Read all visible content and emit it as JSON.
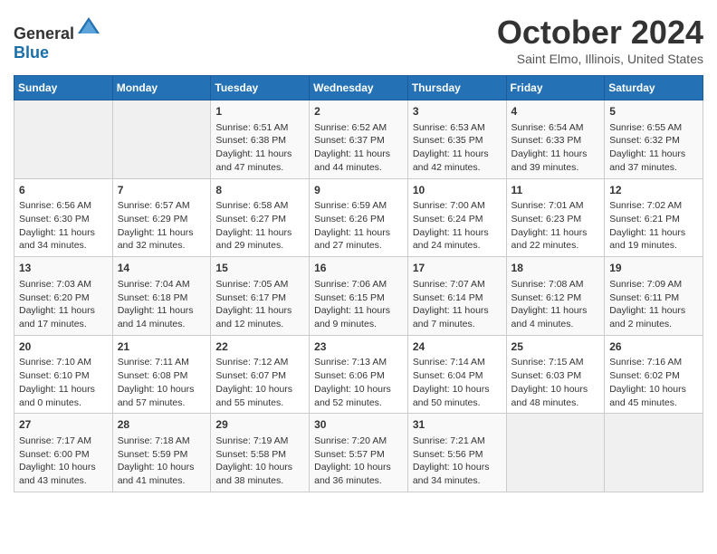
{
  "header": {
    "logo_general": "General",
    "logo_blue": "Blue",
    "month": "October 2024",
    "location": "Saint Elmo, Illinois, United States"
  },
  "days_of_week": [
    "Sunday",
    "Monday",
    "Tuesday",
    "Wednesday",
    "Thursday",
    "Friday",
    "Saturday"
  ],
  "weeks": [
    [
      {
        "day": "",
        "empty": true
      },
      {
        "day": "",
        "empty": true
      },
      {
        "day": "1",
        "sunrise": "Sunrise: 6:51 AM",
        "sunset": "Sunset: 6:38 PM",
        "daylight": "Daylight: 11 hours and 47 minutes."
      },
      {
        "day": "2",
        "sunrise": "Sunrise: 6:52 AM",
        "sunset": "Sunset: 6:37 PM",
        "daylight": "Daylight: 11 hours and 44 minutes."
      },
      {
        "day": "3",
        "sunrise": "Sunrise: 6:53 AM",
        "sunset": "Sunset: 6:35 PM",
        "daylight": "Daylight: 11 hours and 42 minutes."
      },
      {
        "day": "4",
        "sunrise": "Sunrise: 6:54 AM",
        "sunset": "Sunset: 6:33 PM",
        "daylight": "Daylight: 11 hours and 39 minutes."
      },
      {
        "day": "5",
        "sunrise": "Sunrise: 6:55 AM",
        "sunset": "Sunset: 6:32 PM",
        "daylight": "Daylight: 11 hours and 37 minutes."
      }
    ],
    [
      {
        "day": "6",
        "sunrise": "Sunrise: 6:56 AM",
        "sunset": "Sunset: 6:30 PM",
        "daylight": "Daylight: 11 hours and 34 minutes."
      },
      {
        "day": "7",
        "sunrise": "Sunrise: 6:57 AM",
        "sunset": "Sunset: 6:29 PM",
        "daylight": "Daylight: 11 hours and 32 minutes."
      },
      {
        "day": "8",
        "sunrise": "Sunrise: 6:58 AM",
        "sunset": "Sunset: 6:27 PM",
        "daylight": "Daylight: 11 hours and 29 minutes."
      },
      {
        "day": "9",
        "sunrise": "Sunrise: 6:59 AM",
        "sunset": "Sunset: 6:26 PM",
        "daylight": "Daylight: 11 hours and 27 minutes."
      },
      {
        "day": "10",
        "sunrise": "Sunrise: 7:00 AM",
        "sunset": "Sunset: 6:24 PM",
        "daylight": "Daylight: 11 hours and 24 minutes."
      },
      {
        "day": "11",
        "sunrise": "Sunrise: 7:01 AM",
        "sunset": "Sunset: 6:23 PM",
        "daylight": "Daylight: 11 hours and 22 minutes."
      },
      {
        "day": "12",
        "sunrise": "Sunrise: 7:02 AM",
        "sunset": "Sunset: 6:21 PM",
        "daylight": "Daylight: 11 hours and 19 minutes."
      }
    ],
    [
      {
        "day": "13",
        "sunrise": "Sunrise: 7:03 AM",
        "sunset": "Sunset: 6:20 PM",
        "daylight": "Daylight: 11 hours and 17 minutes."
      },
      {
        "day": "14",
        "sunrise": "Sunrise: 7:04 AM",
        "sunset": "Sunset: 6:18 PM",
        "daylight": "Daylight: 11 hours and 14 minutes."
      },
      {
        "day": "15",
        "sunrise": "Sunrise: 7:05 AM",
        "sunset": "Sunset: 6:17 PM",
        "daylight": "Daylight: 11 hours and 12 minutes."
      },
      {
        "day": "16",
        "sunrise": "Sunrise: 7:06 AM",
        "sunset": "Sunset: 6:15 PM",
        "daylight": "Daylight: 11 hours and 9 minutes."
      },
      {
        "day": "17",
        "sunrise": "Sunrise: 7:07 AM",
        "sunset": "Sunset: 6:14 PM",
        "daylight": "Daylight: 11 hours and 7 minutes."
      },
      {
        "day": "18",
        "sunrise": "Sunrise: 7:08 AM",
        "sunset": "Sunset: 6:12 PM",
        "daylight": "Daylight: 11 hours and 4 minutes."
      },
      {
        "day": "19",
        "sunrise": "Sunrise: 7:09 AM",
        "sunset": "Sunset: 6:11 PM",
        "daylight": "Daylight: 11 hours and 2 minutes."
      }
    ],
    [
      {
        "day": "20",
        "sunrise": "Sunrise: 7:10 AM",
        "sunset": "Sunset: 6:10 PM",
        "daylight": "Daylight: 11 hours and 0 minutes."
      },
      {
        "day": "21",
        "sunrise": "Sunrise: 7:11 AM",
        "sunset": "Sunset: 6:08 PM",
        "daylight": "Daylight: 10 hours and 57 minutes."
      },
      {
        "day": "22",
        "sunrise": "Sunrise: 7:12 AM",
        "sunset": "Sunset: 6:07 PM",
        "daylight": "Daylight: 10 hours and 55 minutes."
      },
      {
        "day": "23",
        "sunrise": "Sunrise: 7:13 AM",
        "sunset": "Sunset: 6:06 PM",
        "daylight": "Daylight: 10 hours and 52 minutes."
      },
      {
        "day": "24",
        "sunrise": "Sunrise: 7:14 AM",
        "sunset": "Sunset: 6:04 PM",
        "daylight": "Daylight: 10 hours and 50 minutes."
      },
      {
        "day": "25",
        "sunrise": "Sunrise: 7:15 AM",
        "sunset": "Sunset: 6:03 PM",
        "daylight": "Daylight: 10 hours and 48 minutes."
      },
      {
        "day": "26",
        "sunrise": "Sunrise: 7:16 AM",
        "sunset": "Sunset: 6:02 PM",
        "daylight": "Daylight: 10 hours and 45 minutes."
      }
    ],
    [
      {
        "day": "27",
        "sunrise": "Sunrise: 7:17 AM",
        "sunset": "Sunset: 6:00 PM",
        "daylight": "Daylight: 10 hours and 43 minutes."
      },
      {
        "day": "28",
        "sunrise": "Sunrise: 7:18 AM",
        "sunset": "Sunset: 5:59 PM",
        "daylight": "Daylight: 10 hours and 41 minutes."
      },
      {
        "day": "29",
        "sunrise": "Sunrise: 7:19 AM",
        "sunset": "Sunset: 5:58 PM",
        "daylight": "Daylight: 10 hours and 38 minutes."
      },
      {
        "day": "30",
        "sunrise": "Sunrise: 7:20 AM",
        "sunset": "Sunset: 5:57 PM",
        "daylight": "Daylight: 10 hours and 36 minutes."
      },
      {
        "day": "31",
        "sunrise": "Sunrise: 7:21 AM",
        "sunset": "Sunset: 5:56 PM",
        "daylight": "Daylight: 10 hours and 34 minutes."
      },
      {
        "day": "",
        "empty": true
      },
      {
        "day": "",
        "empty": true
      }
    ]
  ]
}
